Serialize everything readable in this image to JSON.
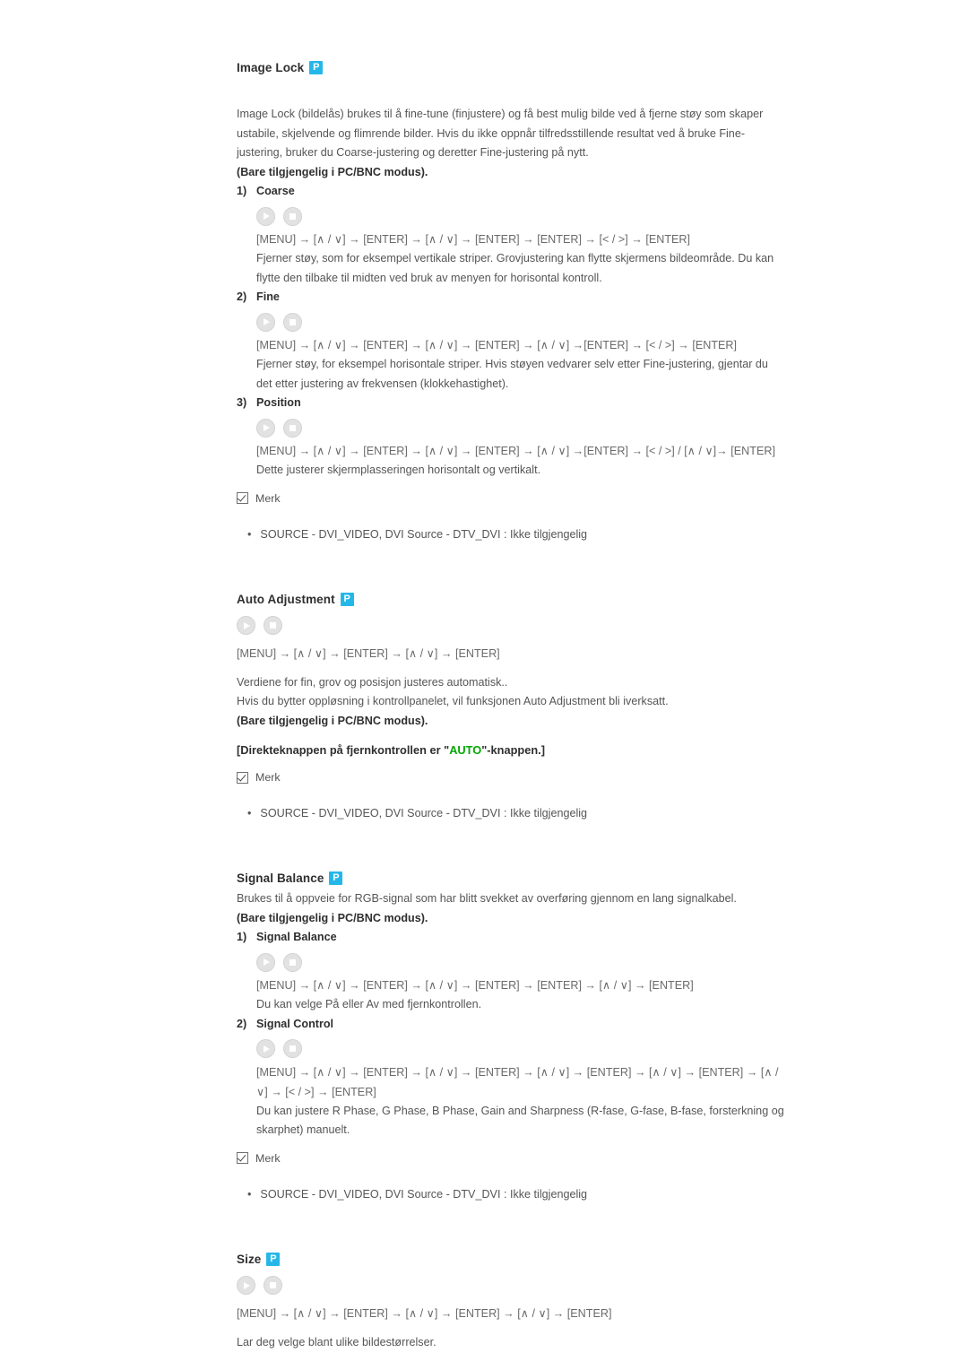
{
  "badge": {
    "label": "P",
    "color": "#25b7e8"
  },
  "sections": [
    {
      "id": "image-lock",
      "title": "Image Lock",
      "intro": "Image Lock (bildelås) brukes til å fine-tune (finjustere) og få best mulig bilde ved å fjerne støy som skaper ustabile, skjelvende og flimrende bilder. Hvis du ikke oppnår tilfredsstillende resultat ved å bruke Fine-justering, bruker du Coarse-justering og deretter Fine-justering på nytt.",
      "mode_note": "(Bare tilgjengelig i PC/BNC modus).",
      "items": [
        {
          "num": "1)",
          "title": "Coarse",
          "command": "[MENU] → [∧ / ∨] → [ENTER] → [∧ / ∨] → [ENTER] → [ENTER] → [< / >] → [ENTER]",
          "desc": "Fjerner støy, som for eksempel vertikale striper. Grovjustering kan flytte skjermens bildeområde. Du kan flytte den tilbake til midten ved bruk av menyen for horisontal kontroll."
        },
        {
          "num": "2)",
          "title": "Fine",
          "command": "[MENU] → [∧ / ∨] → [ENTER] → [∧ / ∨] → [ENTER] → [∧ / ∨] →[ENTER] → [< / >] → [ENTER]",
          "desc": "Fjerner støy, for eksempel horisontale striper. Hvis støyen vedvarer selv etter Fine-justering, gjentar du det etter justering av frekvensen (klokkehastighet)."
        },
        {
          "num": "3)",
          "title": "Position",
          "command": "[MENU] → [∧ / ∨] → [ENTER] → [∧ / ∨] → [ENTER] → [∧ / ∨] →[ENTER] → [< / >] / [∧ / ∨]→ [ENTER]",
          "desc": "Dette justerer skjermplasseringen horisontalt og vertikalt."
        }
      ],
      "merk_label": "Merk",
      "bullet": "SOURCE - DVI_VIDEO, DVI Source - DTV_DVI : Ikke tilgjengelig"
    },
    {
      "id": "auto-adjustment",
      "title": "Auto Adjustment",
      "command": "[MENU] → [∧ / ∨] → [ENTER] → [∧ / ∨] → [ENTER]",
      "desc_line1": "Verdiene for fin, grov og posisjon justeres automatisk..",
      "desc_line2": "Hvis du bytter oppløsning i kontrollpanelet, vil funksjonen Auto Adjustment bli iverksatt.",
      "mode_note": "(Bare tilgjengelig i PC/BNC modus).",
      "direct_prefix": "[Direkteknappen på fjernkontrollen er \"",
      "direct_highlight": "AUTO",
      "direct_suffix": "\"-knappen.]",
      "merk_label": "Merk",
      "bullet": "SOURCE - DVI_VIDEO, DVI Source - DTV_DVI : Ikke tilgjengelig"
    },
    {
      "id": "signal-balance",
      "title": "Signal Balance",
      "intro": "Brukes til å oppveie for RGB-signal som har blitt svekket av overføring gjennom en lang signalkabel.",
      "mode_note": "(Bare tilgjengelig i PC/BNC modus).",
      "items": [
        {
          "num": "1)",
          "title": "Signal Balance",
          "command": "[MENU] → [∧ / ∨] → [ENTER] → [∧ / ∨] → [ENTER] → [ENTER] → [∧ / ∨] → [ENTER]",
          "desc": "Du kan velge På eller Av med fjernkontrollen."
        },
        {
          "num": "2)",
          "title": "Signal Control",
          "command": "[MENU] → [∧ / ∨] → [ENTER] → [∧ / ∨] → [ENTER] → [∧ / ∨] → [ENTER] → [∧ / ∨] → [ENTER] → [∧ / ∨] → [< / >] → [ENTER]",
          "desc": "Du kan justere R Phase, G Phase, B Phase, Gain and Sharpness (R-fase, G-fase, B-fase, forsterkning og skarphet) manuelt."
        }
      ],
      "merk_label": "Merk",
      "bullet": "SOURCE - DVI_VIDEO, DVI Source - DTV_DVI : Ikke tilgjengelig"
    },
    {
      "id": "size",
      "title": "Size",
      "command": "[MENU] → [∧ / ∨] → [ENTER] → [∧ / ∨] → [ENTER] → [∧ / ∨] → [ENTER]",
      "desc": "Lar deg velge blant ulike bildestørrelser."
    }
  ],
  "icons": {
    "play": "play-icon",
    "stop": "stop-icon",
    "check": "checkbox-checked-icon"
  }
}
